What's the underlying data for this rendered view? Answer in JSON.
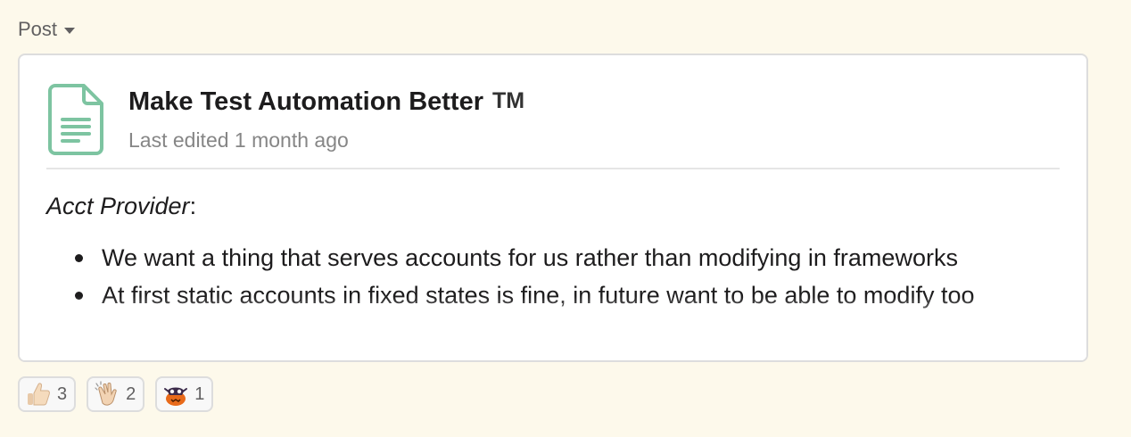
{
  "post_type": {
    "label": "Post"
  },
  "post": {
    "title": "Make Test Automation Better",
    "trademark": "TM",
    "subtitle": "Last edited 1 month ago",
    "section_heading": "Acct Provider",
    "section_heading_suffix": ":",
    "bullets": [
      "We want a thing that serves accounts for us rather than modifying in frameworks",
      "At first static accounts in fixed states is fine, in future want to be able to modify too"
    ],
    "icon": "document-icon",
    "icon_color": "#7dc4a1"
  },
  "reactions": [
    {
      "emoji": "thumbs-up-icon",
      "count": "3"
    },
    {
      "emoji": "clapping-hands-icon",
      "count": "2"
    },
    {
      "emoji": "pumpkin-character-icon",
      "count": "1"
    }
  ],
  "colors": {
    "background": "#fdf9eb",
    "card": "#ffffff",
    "border": "#dddddd",
    "muted_text": "#868686"
  }
}
